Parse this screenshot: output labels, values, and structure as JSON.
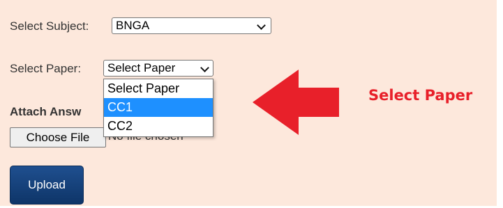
{
  "subject": {
    "label": "Select Subject:",
    "selected": "BNGA"
  },
  "paper": {
    "label": "Select Paper:",
    "selected": "Select Paper",
    "options": [
      "Select Paper",
      "CC1",
      "CC2"
    ],
    "highlighted_index": 1
  },
  "attach": {
    "label": "Attach Answ",
    "choose_button": "Choose File",
    "status": "No file chosen"
  },
  "upload_button": "Upload",
  "annotation": {
    "text": "Select Paper",
    "color": "#e8202a"
  },
  "colors": {
    "panel_background": "#fde8dc",
    "highlight": "#1e90ff",
    "upload_button": "#0e3568"
  }
}
